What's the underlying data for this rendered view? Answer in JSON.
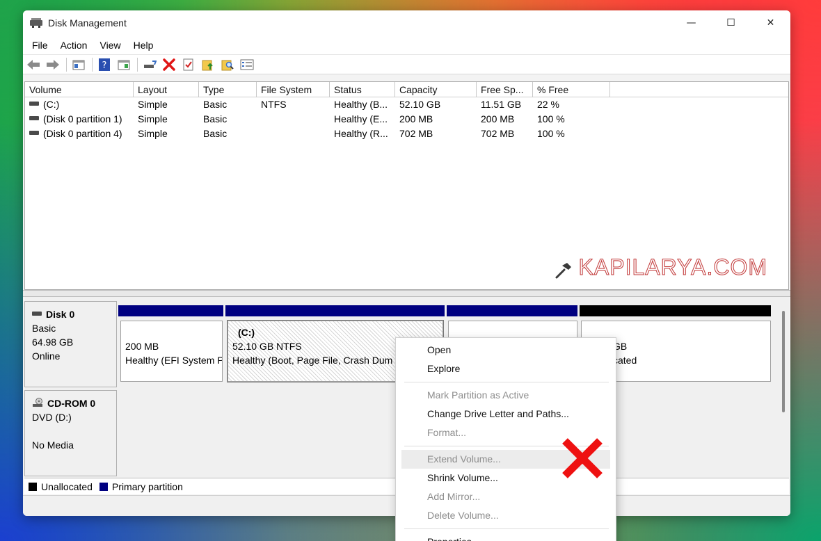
{
  "window": {
    "title": "Disk Management",
    "controls": {
      "minimize": "—",
      "maximize": "☐",
      "close": "✕"
    }
  },
  "menubar": [
    "File",
    "Action",
    "View",
    "Help"
  ],
  "volume_list": {
    "columns": [
      "Volume",
      "Layout",
      "Type",
      "File System",
      "Status",
      "Capacity",
      "Free Sp...",
      "% Free"
    ],
    "rows": [
      [
        "(C:)",
        "Simple",
        "Basic",
        "NTFS",
        "Healthy (B...",
        "52.10 GB",
        "11.51 GB",
        "22 %"
      ],
      [
        "(Disk 0 partition 1)",
        "Simple",
        "Basic",
        "",
        "Healthy (E...",
        "200 MB",
        "200 MB",
        "100 %"
      ],
      [
        "(Disk 0 partition 4)",
        "Simple",
        "Basic",
        "",
        "Healthy (R...",
        "702 MB",
        "702 MB",
        "100 %"
      ]
    ]
  },
  "watermark": "KAPILARYA.COM",
  "disk0": {
    "name": "Disk 0",
    "type": "Basic",
    "size": "64.98 GB",
    "state": "Online",
    "partitions": [
      {
        "line1": "200 MB",
        "line2": "Healthy (EFI System P"
      },
      {
        "title": "(C:)",
        "line1": "52.10 GB NTFS",
        "line2": "Healthy (Boot, Page File, Crash Dum"
      },
      {
        "line1": "",
        "line2": ""
      },
      {
        "line1": "GB",
        "line2": "cated"
      }
    ]
  },
  "cdrom0": {
    "name": "CD-ROM 0",
    "type": "DVD (D:)",
    "state": "No Media"
  },
  "legend": {
    "unallocated": "Unallocated",
    "primary": "Primary partition"
  },
  "colors": {
    "primary_bar": "#000080",
    "unallocated_bar": "#000000"
  },
  "context_menu": {
    "open": "Open",
    "explore": "Explore",
    "mark_active": "Mark Partition as Active",
    "change_letter": "Change Drive Letter and Paths...",
    "format": "Format...",
    "extend": "Extend Volume...",
    "shrink": "Shrink Volume...",
    "add_mirror": "Add Mirror...",
    "delete": "Delete Volume...",
    "properties": "Properties"
  }
}
